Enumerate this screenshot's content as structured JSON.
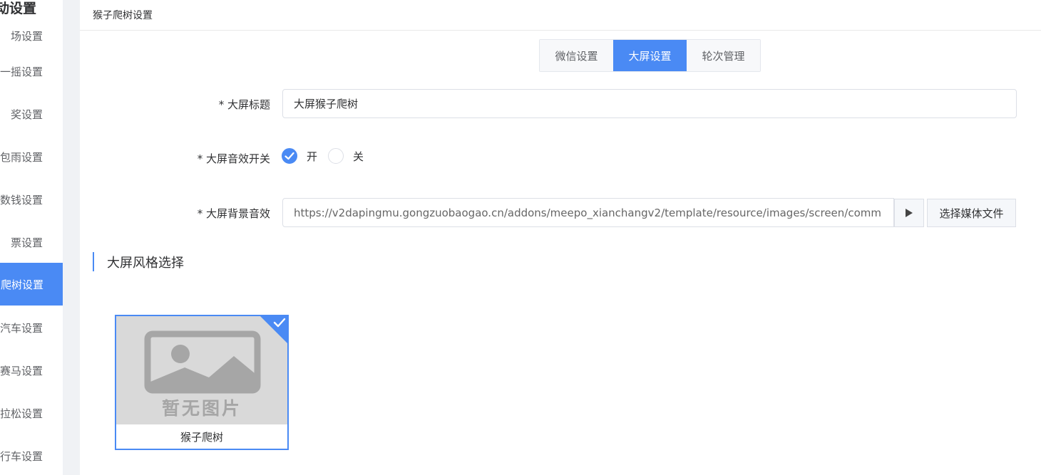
{
  "sidebar": {
    "title": "动设置",
    "items": [
      {
        "label": "场设置"
      },
      {
        "label": "一摇设置"
      },
      {
        "label": "奖设置"
      },
      {
        "label": "包雨设置"
      },
      {
        "label": "数钱设置"
      },
      {
        "label": "票设置"
      },
      {
        "label": "爬树设置",
        "active": true
      },
      {
        "label": "汽车设置"
      },
      {
        "label": "赛马设置"
      },
      {
        "label": "拉松设置"
      },
      {
        "label": "行车设置"
      }
    ]
  },
  "panel": {
    "title": "猴子爬树设置"
  },
  "tabs": [
    {
      "label": "微信设置"
    },
    {
      "label": "大屏设置",
      "active": true
    },
    {
      "label": "轮次管理"
    }
  ],
  "form": {
    "screen_title_label": "* 大屏标题",
    "screen_title_value": "大屏猴子爬树",
    "sound_switch_label": "* 大屏音效开关",
    "sound_on_label": "开",
    "sound_off_label": "关",
    "sound_selected": "开",
    "bg_sound_label": "* 大屏背景音效",
    "bg_sound_value": "https://v2dapingmu.gongzuobaogao.cn/addons/meepo_xianchangv2/template/resource/images/screen/comm",
    "play_icon": "play-icon",
    "choose_media_label": "选择媒体文件"
  },
  "style_section": {
    "title": "大屏风格选择",
    "cards": [
      {
        "caption": "猴子爬树",
        "placeholder_text": "暂无图片",
        "selected": true
      }
    ]
  },
  "colors": {
    "accent": "#4a8af4",
    "gutter": "#f0f2f5",
    "placeholder": "#d9d9d9"
  }
}
